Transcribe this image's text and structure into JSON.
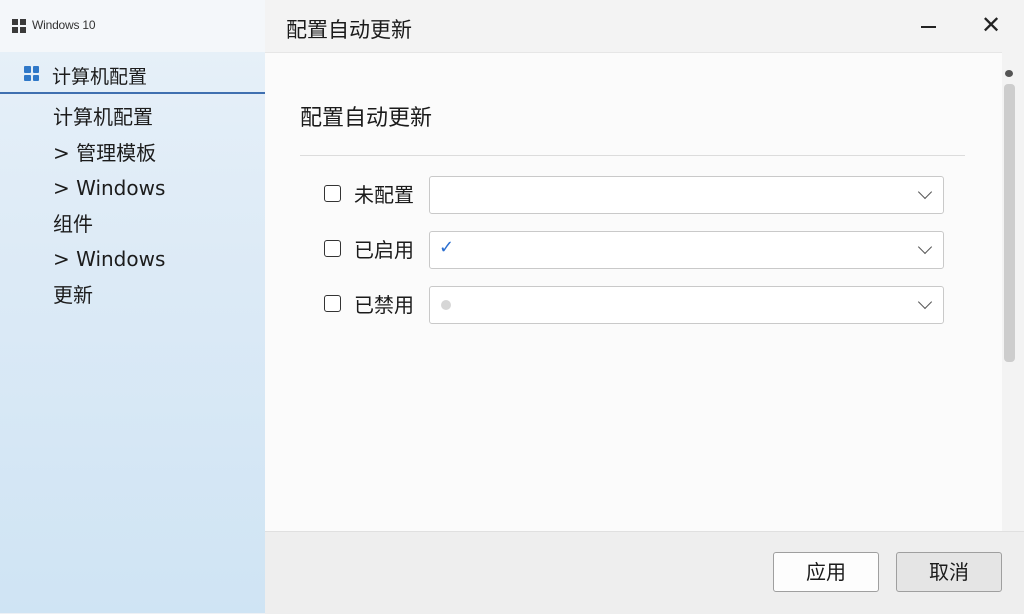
{
  "app": {
    "title": "Windows 10"
  },
  "sidebar": {
    "header": "计算机配置",
    "items": [
      {
        "text": "计算机配置"
      },
      {
        "text": "> 管理模板"
      },
      {
        "text": "> Windows"
      },
      {
        "text": "组件"
      },
      {
        "text": "> Windows"
      },
      {
        "text": "更新"
      }
    ]
  },
  "window": {
    "title": "配置自动更新",
    "minimize_icon": "minimize-icon",
    "close_glyph": "✕"
  },
  "content": {
    "heading": "配置自动更新",
    "options": [
      {
        "label": "未配置",
        "checked": false,
        "select_value": "",
        "select_icon": "none"
      },
      {
        "label": "已启用",
        "checked": false,
        "select_value": "✓",
        "select_icon": "check-icon"
      },
      {
        "label": "已禁用",
        "checked": false,
        "select_value": "",
        "select_icon": "dot-icon"
      }
    ]
  },
  "footer": {
    "apply_label": "应用",
    "cancel_label": "取消"
  },
  "colors": {
    "accent": "#2f78c8",
    "sidebar_underline": "#3f6fb0"
  }
}
